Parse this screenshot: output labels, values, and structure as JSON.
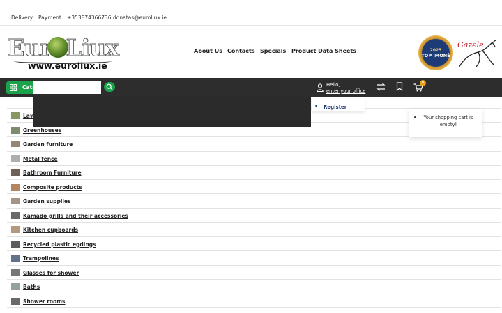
{
  "topbar": {
    "links": [
      "Delivery",
      "Payment",
      "+353874366736",
      "donatas@euroliux.ie"
    ]
  },
  "logo": {
    "word": "EuroLiux",
    "url": "www.euroliux.ie"
  },
  "nav": {
    "items": [
      "About Us",
      "Contacts",
      "Specials",
      "Product Data Sheets"
    ]
  },
  "badges": {
    "top_year": "2025",
    "top_text": "TOP ĮMONĖ",
    "gazele": "Gazele"
  },
  "toolbar": {
    "catalog_label": "Cata",
    "search_placeholder": "",
    "hello": "Hello,",
    "account_link": "enter your office",
    "cart_count": "0"
  },
  "account_menu": {
    "register": "Register"
  },
  "cart_popup": {
    "message": "Your shopping cart is empty!"
  },
  "categories": [
    {
      "label": "Law",
      "icon": "lawn-icon"
    },
    {
      "label": "Greenhouses",
      "icon": "greenhouse-icon"
    },
    {
      "label": "Garden furniture",
      "icon": "garden-furniture-icon"
    },
    {
      "label": "Metal fence",
      "icon": "fence-icon"
    },
    {
      "label": "Bathroom Furniture",
      "icon": "bathroom-furniture-icon"
    },
    {
      "label": "Composite products",
      "icon": "composite-icon"
    },
    {
      "label": "Garden supplies",
      "icon": "garden-supplies-icon"
    },
    {
      "label": "Kamado grills and their accessories",
      "icon": "grill-icon"
    },
    {
      "label": "Kitchen cupboards",
      "icon": "cupboard-icon"
    },
    {
      "label": "Recycled plastic egdings",
      "icon": "edging-icon"
    },
    {
      "label": "Trampolines",
      "icon": "trampoline-icon"
    },
    {
      "label": "Glasses for shower",
      "icon": "shower-glass-icon"
    },
    {
      "label": "Baths",
      "icon": "bath-icon"
    },
    {
      "label": "Shower rooms",
      "icon": "shower-room-icon"
    }
  ],
  "colors": {
    "accent": "#1aa34a",
    "dark": "#2d2d2d",
    "cart_badge": "#e8a21a",
    "link_blue": "#1d3b76"
  }
}
